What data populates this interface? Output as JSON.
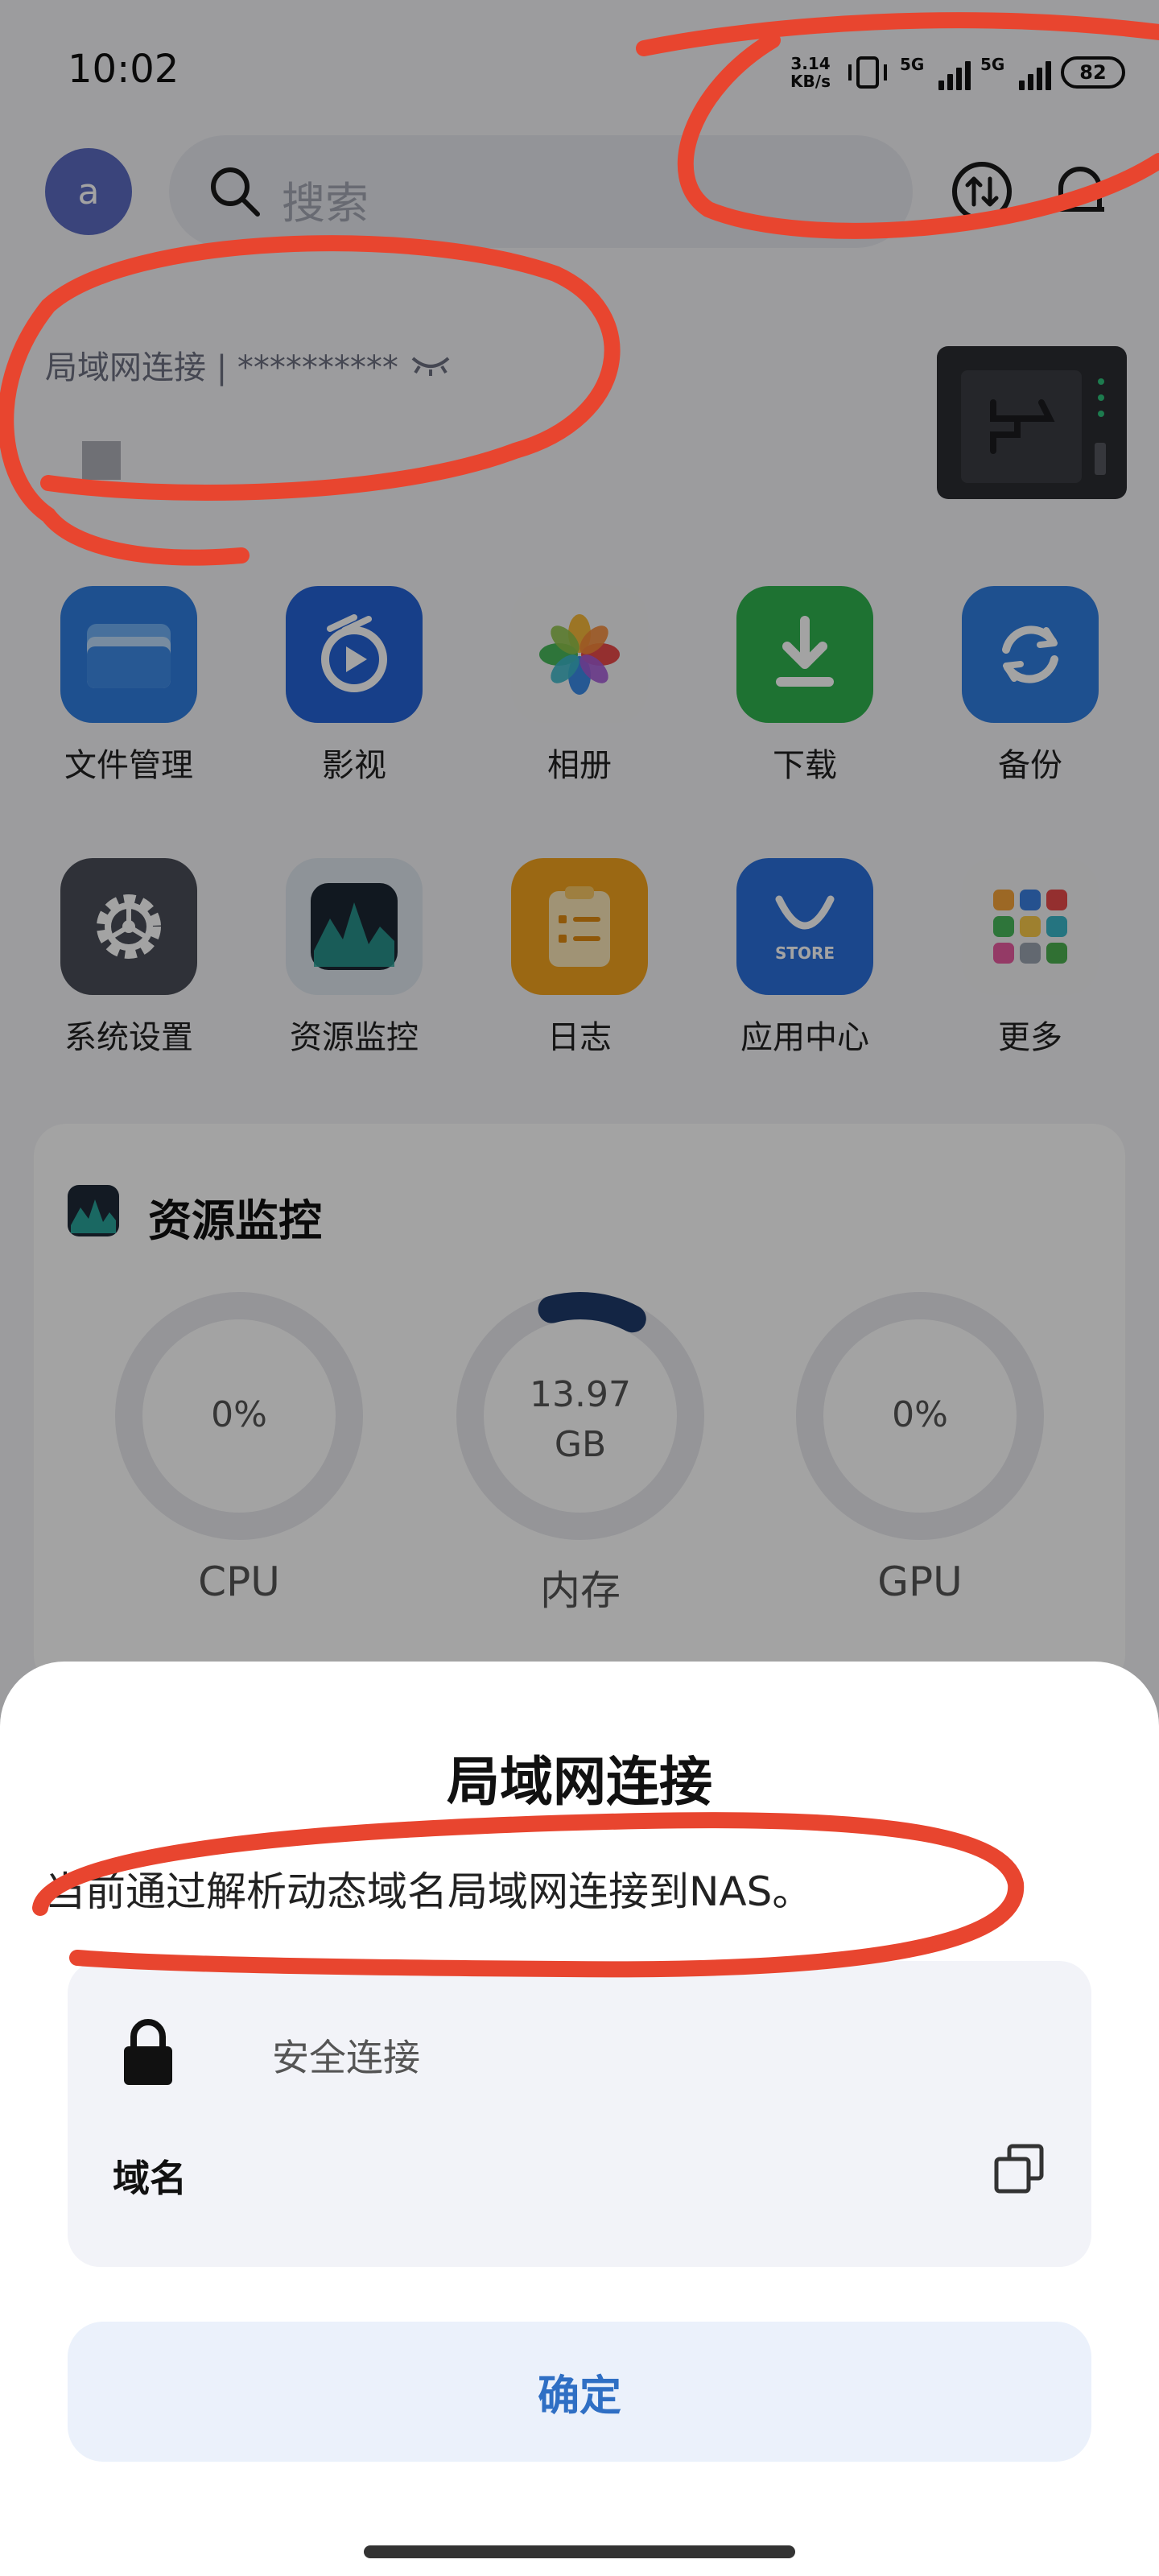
{
  "status_bar": {
    "time": "10:02",
    "net_speed_value": "3.14",
    "net_speed_unit": "KB/s",
    "signal_1_label": "5G",
    "signal_2_label": "5G",
    "battery": "82"
  },
  "header": {
    "avatar_letter": "a",
    "search_placeholder": "搜索"
  },
  "connection": {
    "text": "局域网连接 | **********"
  },
  "apps": [
    {
      "label": "文件管理",
      "icon": "folder-icon"
    },
    {
      "label": "影视",
      "icon": "video-icon"
    },
    {
      "label": "相册",
      "icon": "photos-icon"
    },
    {
      "label": "下载",
      "icon": "download-icon"
    },
    {
      "label": "备份",
      "icon": "backup-icon"
    },
    {
      "label": "系统设置",
      "icon": "gear-icon"
    },
    {
      "label": "资源监控",
      "icon": "monitor-icon"
    },
    {
      "label": "日志",
      "icon": "clipboard-icon"
    },
    {
      "label": "应用中心",
      "icon": "store-icon"
    },
    {
      "label": "更多",
      "icon": "grid-icon"
    }
  ],
  "store_badge": "STORE",
  "monitor": {
    "title": "资源监控",
    "gauges": [
      {
        "label": "CPU",
        "value": "0%",
        "percent": 0
      },
      {
        "label": "内存",
        "value_line1": "13.97",
        "value_line2": "GB",
        "percent": 12
      },
      {
        "label": "GPU",
        "value": "0%",
        "percent": 0
      }
    ]
  },
  "dialog": {
    "title": "局域网连接",
    "description": "当前通过解析动态域名局域网连接到NAS。",
    "secure_label": "安全连接",
    "domain_label": "域名",
    "confirm_label": "确定"
  },
  "colors": {
    "accent": "#2f6fc4",
    "annotation": "#e8452f",
    "gauge_fill": "#1f3b6b"
  }
}
